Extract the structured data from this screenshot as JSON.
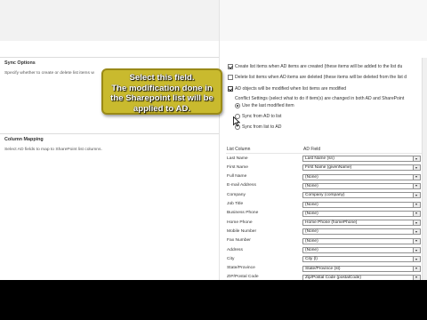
{
  "sync_options": {
    "title": "Sync Options",
    "description": "Specify whether to create or delete list items w",
    "create_items_label": "Create list items when AD items are created (these items will be added to the list du",
    "delete_items_label": "Delete list items when AD items are deleted (these items will be deleted from the list d",
    "modified_label": "AD objects will be modified when list items are modified",
    "conflict_label": "Conflict Settings (select what to do if item(s) are changed in both AD and SharePoint",
    "conflict_options": [
      "Use the last modified item",
      "Sync from AD to list",
      "Sync from list to AD"
    ]
  },
  "callout": {
    "lines": [
      "Select this field.",
      "The modification done in",
      "the Sharepoint list will be",
      "applied to AD."
    ]
  },
  "column_mapping": {
    "title": "Column Mapping",
    "description": "Select AD fields to map to SharePoint list columns.",
    "header_list": "List Column",
    "header_ad": "AD Field",
    "rows": [
      {
        "label": "Last Name",
        "value": "Last Name (sn)"
      },
      {
        "label": "First Name",
        "value": "First Name (givenName)"
      },
      {
        "label": "Full Name",
        "value": "(None)"
      },
      {
        "label": "E-mail Address",
        "value": "(None)"
      },
      {
        "label": "Company",
        "value": "Company (company)"
      },
      {
        "label": "Job Title",
        "value": "(None)"
      },
      {
        "label": "Business Phone",
        "value": "(None)"
      },
      {
        "label": "Home Phone",
        "value": "Home Phone (homePhone)"
      },
      {
        "label": "Mobile Number",
        "value": "(None)"
      },
      {
        "label": "Fax Number",
        "value": "(None)"
      },
      {
        "label": "Address",
        "value": "(None)"
      },
      {
        "label": "City",
        "value": "City (l)"
      },
      {
        "label": "State/Province",
        "value": "State/Province (st)"
      },
      {
        "label": "ZIP/Postal Code",
        "value": "Zip/Postal Code (postalCode)"
      }
    ]
  },
  "colors": {
    "callout_bg": "#c9ba2e",
    "callout_border": "#9a8a17"
  }
}
